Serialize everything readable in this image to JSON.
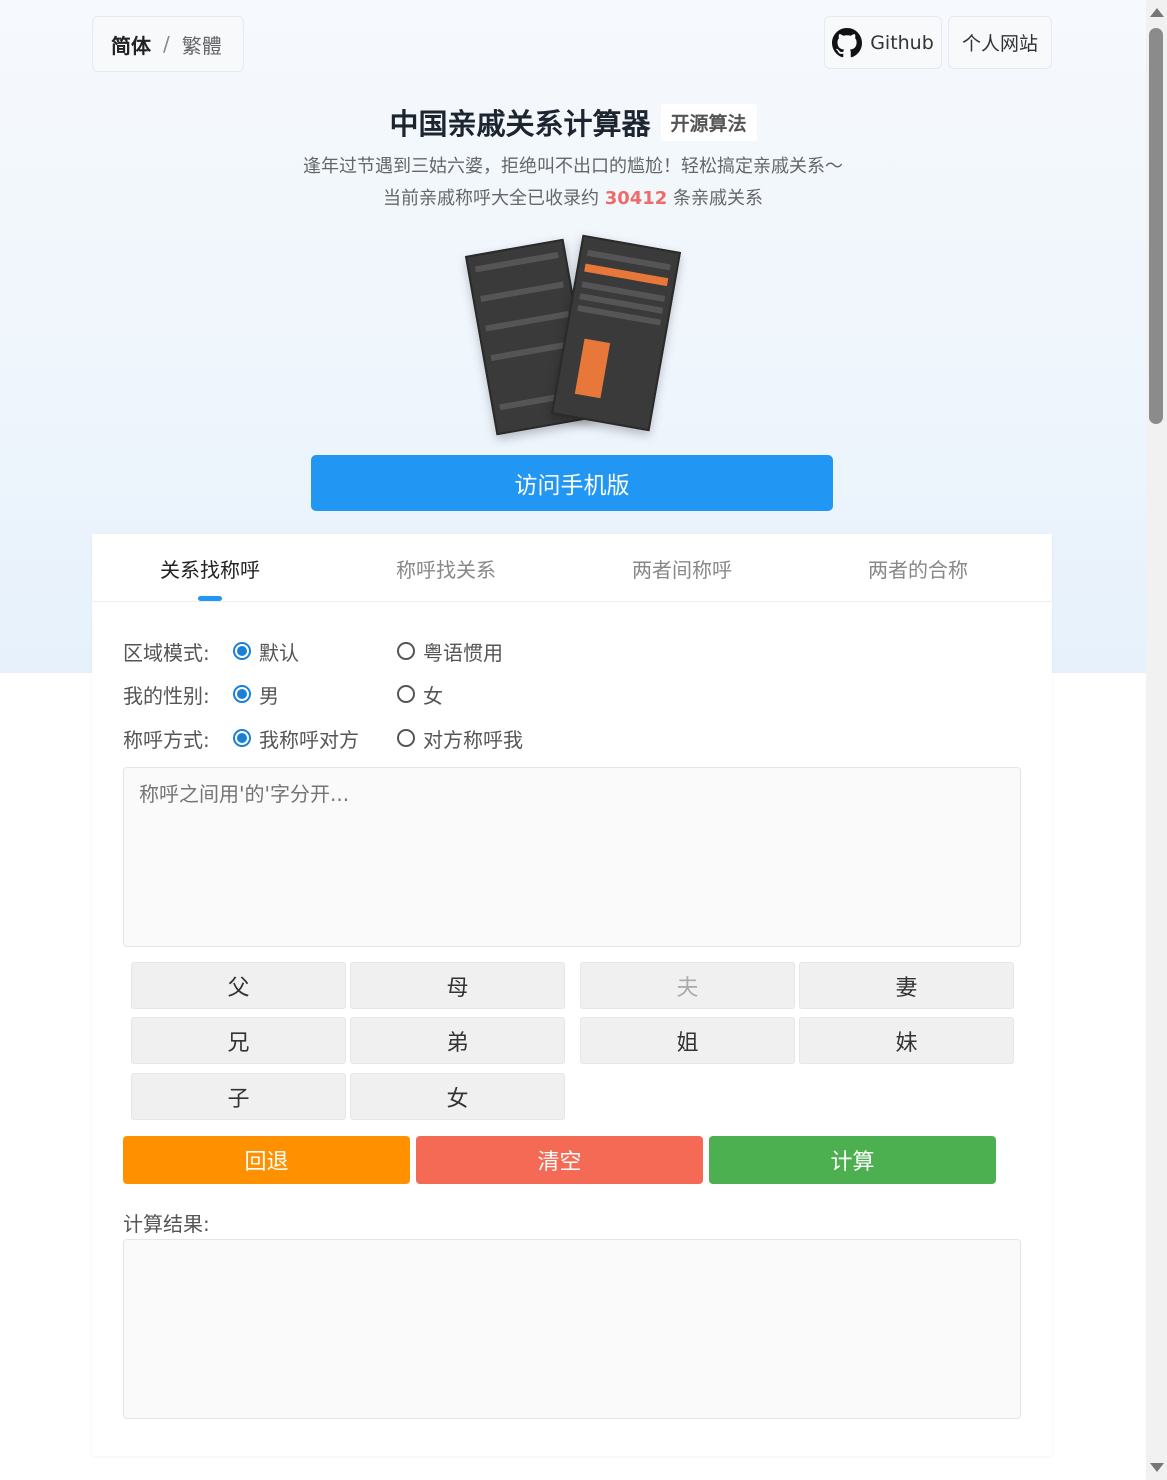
{
  "header": {
    "lang_simplified": "简体",
    "lang_separator": "/",
    "lang_traditional": "繁體",
    "github_label": "Github",
    "site_label": "个人网站"
  },
  "hero": {
    "title": "中国亲戚关系计算器",
    "badge": "开源算法",
    "subtitle_line1": "逢年过节遇到三姑六婆，拒绝叫不出口的尴尬！轻松搞定亲戚关系～",
    "subtitle_line2_prefix": "当前亲戚称呼大全已收录约",
    "relation_count": "30412",
    "subtitle_line2_suffix": "条亲戚关系",
    "mobile_button": "访问手机版"
  },
  "tabs": [
    {
      "label": "关系找称呼",
      "active": true
    },
    {
      "label": "称呼找关系",
      "active": false
    },
    {
      "label": "两者间称呼",
      "active": false
    },
    {
      "label": "两者的合称",
      "active": false
    }
  ],
  "options": {
    "region": {
      "label": "区域模式:",
      "opt1": "默认",
      "opt2": "粤语惯用"
    },
    "gender": {
      "label": "我的性别:",
      "opt1": "男",
      "opt2": "女"
    },
    "mode": {
      "label": "称呼方式:",
      "opt1": "我称呼对方",
      "opt2": "对方称呼我"
    }
  },
  "input": {
    "placeholder": "称呼之间用'的'字分开..."
  },
  "keypad": {
    "father": "父",
    "mother": "母",
    "husband": "夫",
    "wife": "妻",
    "elder_brother": "兄",
    "younger_brother": "弟",
    "elder_sister": "姐",
    "younger_sister": "妹",
    "son": "子",
    "daughter": "女"
  },
  "actions": {
    "back": "回退",
    "clear": "清空",
    "calc": "计算"
  },
  "result": {
    "label": "计算结果:"
  },
  "colors": {
    "primary": "#2196f3",
    "back": "#ff9100",
    "clear": "#f46a55",
    "calc": "#4caf50",
    "count_highlight": "#ee6b6b"
  }
}
